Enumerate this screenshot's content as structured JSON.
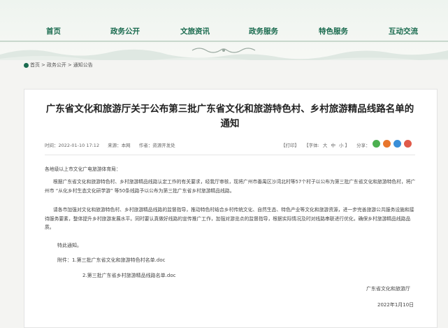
{
  "nav": {
    "items": [
      "首页",
      "政务公开",
      "文旅资讯",
      "政务服务",
      "特色服务",
      "互动交流"
    ]
  },
  "breadcrumb": {
    "home": "首页",
    "sep1": ">",
    "level1": "政务公开",
    "sep2": ">",
    "level2": "通知公告"
  },
  "article": {
    "title_line1": "广东省文化和旅游厅关于公布第三批广东省文化和旅游特色村、乡村旅游精品线路名单的",
    "title_line2": "通知",
    "meta": {
      "date": "时间：2022-01-10 17:12",
      "source": "来源：本网",
      "author": "作者：资源开发处"
    },
    "tools": {
      "print": "【打印】",
      "font_label": "【字体:",
      "large": "大",
      "medium": "中",
      "small": "小",
      "font_end": "】",
      "share_label": "分享："
    },
    "salutation": "各地级以上市文化广电旅游体育局：",
    "para1": "根据广东省文化和旅游特色村、乡村旅游精品线路认定工作的有关要求，经我厅审核，现将广州市番禺区沙湾北村等57个村子以公布为第三批广东省文化和旅游特色村，将广州市 “从化乡村生态文化研学游” 等50条线路予以公布为第三批广东省乡村旅游精品线路。",
    "para2": "请各市加强对文化和旅游特色村、乡村旅游精品线路的监督指导，推动特色村结合乡村传统文化、自然生态、特色产业等文化和旅游资源，进一步完善旅游公共服务设施和接待服务要素，整体提升乡村旅游发展水平。同时要认真做好线路的宣传推广工作，加强对游览点的监督指导，根据实际情况及时对线路串联进行优化，确保乡村旅游精品线路品质。",
    "closing": "特此通知。",
    "attachment1": "附件：1.第三批广东省文化和旅游特色村名单.doc",
    "attachment2": "2.第三批广东省乡村旅游精品线路名单.doc",
    "signature": "广东省文化和旅游厅",
    "date": "2022年1月10日"
  },
  "colors": {
    "brand_green": "#1a6b4f",
    "share_wechat": "#4cb050",
    "share_weibo": "#e8762c",
    "share_qq": "#3a8fd8",
    "share_other": "#e05a4a"
  }
}
